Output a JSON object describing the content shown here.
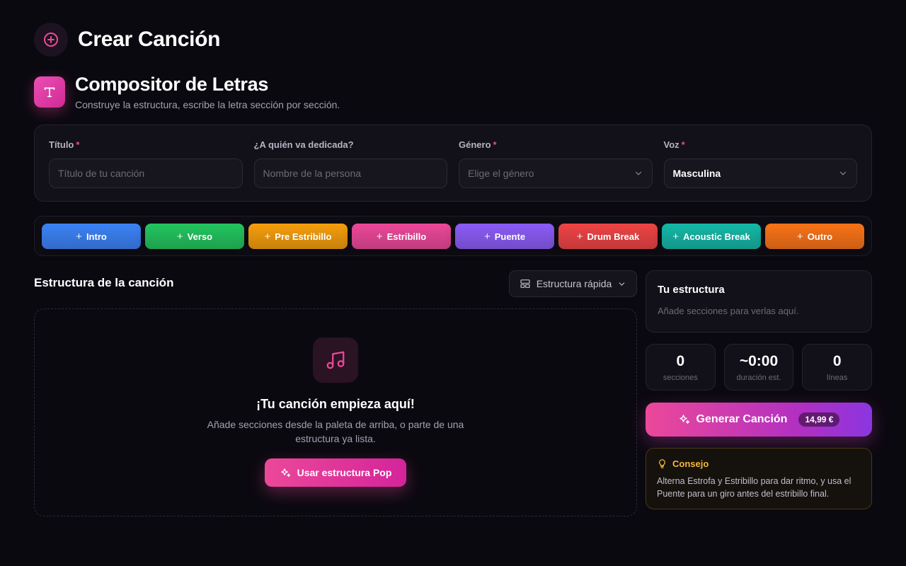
{
  "page": {
    "title": "Crear Canción"
  },
  "composer": {
    "title": "Compositor de Letras",
    "subtitle": "Construye la estructura, escribe la letra sección por sección.",
    "icon": "text-icon"
  },
  "form": {
    "title_field": {
      "label": "Título",
      "required": "*",
      "placeholder": "Título de tu canción"
    },
    "dedication_field": {
      "label": "¿A quién va dedicada?",
      "placeholder": "Nombre de la persona"
    },
    "genre_field": {
      "label": "Género",
      "required": "*",
      "placeholder": "Elige el género"
    },
    "voice_field": {
      "label": "Voz",
      "required": "*",
      "value": "Masculina"
    }
  },
  "palette": {
    "buttons": [
      {
        "label": "Intro",
        "color": "#3b82f6"
      },
      {
        "label": "Verso",
        "color": "#22c55e"
      },
      {
        "label": "Pre Estribillo",
        "color": "#f59e0b"
      },
      {
        "label": "Estribillo",
        "color": "#ec4899"
      },
      {
        "label": "Puente",
        "color": "#8b5cf6"
      },
      {
        "label": "Drum Break",
        "color": "#ef4444"
      },
      {
        "label": "Acoustic Break",
        "color": "#14b8a6"
      },
      {
        "label": "Outro",
        "color": "#f97316"
      }
    ]
  },
  "structure": {
    "title": "Estructura de la canción",
    "quick_label": "Estructura rápida",
    "empty_title": "¡Tu canción empieza aquí!",
    "empty_sub": "Añade secciones desde la paleta de arriba, o parte de una estructura ya lista.",
    "pop_button": "Usar estructura Pop"
  },
  "your_structure": {
    "title": "Tu estructura",
    "subtitle": "Añade secciones para verlas aquí."
  },
  "stats": [
    {
      "value": "0",
      "label": "secciones"
    },
    {
      "value": "~0:00",
      "label": "duración est."
    },
    {
      "value": "0",
      "label": "líneas"
    }
  ],
  "generate": {
    "label": "Generar Canción",
    "price": "14,99 €"
  },
  "tip": {
    "title": "Consejo",
    "text": "Alterna Estrofa y Estribillo para dar ritmo, y usa el Puente para un giro antes del estribillo final."
  }
}
